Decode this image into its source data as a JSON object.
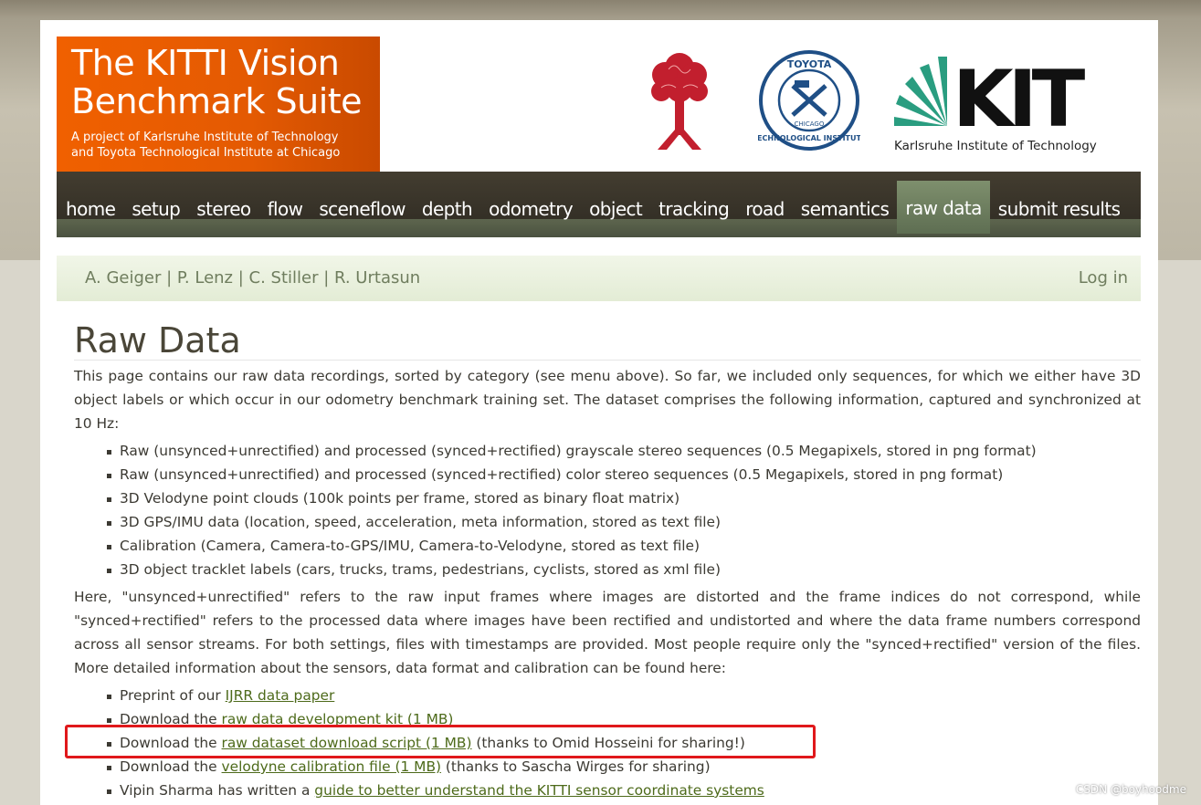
{
  "logo": {
    "title_line1": "The KITTI Vision",
    "title_line2": "Benchmark Suite",
    "sub_line1": "A project of Karlsruhe Institute of Technology",
    "sub_line2": "and Toyota Technological Institute at Chicago"
  },
  "partners": {
    "tti_seal_text_top": "TOYOTA",
    "tti_seal_text_bottom": "TECHNOLOGICAL INSTITUTE",
    "tti_seal_center": "CHICAGO",
    "kit_logo_text": "KIT",
    "kit_name": "Karlsruhe Institute of Technology"
  },
  "nav": {
    "items": [
      "home",
      "setup",
      "stereo",
      "flow",
      "sceneflow",
      "depth",
      "odometry",
      "object",
      "tracking",
      "road",
      "semantics",
      "raw data",
      "submit results"
    ],
    "active": "raw data"
  },
  "authors": {
    "names": "A. Geiger | P. Lenz | C. Stiller | R. Urtasun",
    "login": "Log in"
  },
  "content": {
    "title": "Raw Data",
    "intro": "This page contains our raw data recordings, sorted by category (see menu above). So far, we included only sequences, for which we either have 3D object labels or which occur in our odometry benchmark training set. The dataset comprises the following information, captured and synchronized at 10 Hz:",
    "features": [
      "Raw (unsynced+unrectified) and processed (synced+rectified) grayscale stereo sequences (0.5 Megapixels, stored in png format)",
      "Raw (unsynced+unrectified) and processed (synced+rectified) color stereo sequences (0.5 Megapixels, stored in png format)",
      "3D Velodyne point clouds (100k points per frame, stored as binary float matrix)",
      "3D GPS/IMU data (location, speed, acceleration, meta information, stored as text file)",
      "Calibration (Camera, Camera-to-GPS/IMU, Camera-to-Velodyne, stored as text file)",
      "3D object tracklet labels (cars, trucks, trams, pedestrians, cyclists, stored as xml file)"
    ],
    "explanation": "Here, \"unsynced+unrectified\" refers to the raw input frames where images are distorted and the frame indices do not correspond, while \"synced+rectified\" refers to the processed data where images have been rectified and undistorted and where the data frame numbers correspond across all sensor streams. For both settings, files with timestamps are provided. Most people require only the \"synced+rectified\" version of the files. More detailed information about the sensors, data format and calibration can be found here:",
    "resources": {
      "r1_pre": "Preprint of our ",
      "r1_link": "IJRR data paper",
      "r2_pre": "Download the ",
      "r2_link": "raw data development kit (1 MB)",
      "r3_pre": "Download the ",
      "r3_link": "raw dataset download script (1 MB)",
      "r3_post": " (thanks to Omid Hosseini for sharing!)",
      "r4_pre": "Download the ",
      "r4_link": "velodyne calibration file (1 MB)",
      "r4_post": " (thanks to Sascha Wirges for sharing)",
      "r5_pre": "Vipin Sharma has written a ",
      "r5_link": "guide to better understand the KITTI sensor coordinate systems"
    }
  },
  "watermark": "CSDN @boyhoodme",
  "colors": {
    "logo_orange": "#f06000",
    "nav_dark": "#3a3529",
    "nav_active": "#6f8060",
    "author_bar": "#e8f0dc",
    "link_green": "#4d6a1a",
    "highlight_red": "#e0181b"
  }
}
